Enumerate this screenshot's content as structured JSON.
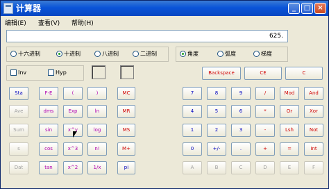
{
  "window": {
    "title": "计算器",
    "controls": [
      "_",
      "□",
      "×"
    ]
  },
  "menu": [
    "编辑(E)",
    "查看(V)",
    "帮助(H)"
  ],
  "display": {
    "value": "625."
  },
  "base_radios": [
    {
      "label": "十六进制",
      "selected": false
    },
    {
      "label": "十进制",
      "selected": true
    },
    {
      "label": "八进制",
      "selected": false
    },
    {
      "label": "二进制",
      "selected": false
    }
  ],
  "angle_radios": [
    {
      "label": "角度",
      "selected": true
    },
    {
      "label": "弧度",
      "selected": false
    },
    {
      "label": "梯度",
      "selected": false
    }
  ],
  "checks": [
    {
      "label": "Inv"
    },
    {
      "label": "Hyp"
    }
  ],
  "top_buttons": [
    "Backspace",
    "CE",
    "C"
  ],
  "left_col": [
    "Sta",
    "Ave",
    "Sum",
    "s",
    "Dat"
  ],
  "sci": [
    [
      "F-E",
      "(",
      ")"
    ],
    [
      "dms",
      "Exp",
      "ln"
    ],
    [
      "sin",
      "x^y",
      "log"
    ],
    [
      "cos",
      "x^3",
      "n!"
    ],
    [
      "tan",
      "x^2",
      "1/x"
    ]
  ],
  "mem": [
    "MC",
    "MR",
    "MS",
    "M+",
    "pi"
  ],
  "num": [
    [
      "7",
      "8",
      "9",
      "/",
      "Mod",
      "And"
    ],
    [
      "4",
      "5",
      "6",
      "*",
      "Or",
      "Xor"
    ],
    [
      "1",
      "2",
      "3",
      "-",
      "Lsh",
      "Not"
    ],
    [
      "0",
      "+/-",
      ".",
      "+",
      "=",
      "Int"
    ],
    [
      "A",
      "B",
      "C",
      "D",
      "E",
      "F"
    ]
  ]
}
